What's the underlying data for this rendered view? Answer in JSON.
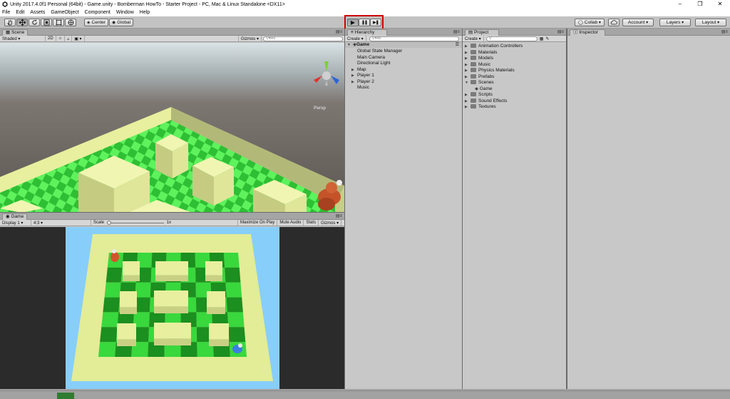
{
  "window": {
    "title": "Unity 2017.4.0f1 Personal (64bit) - Game.unity - Bomberman HowTo - Starter Project - PC, Mac & Linux Standalone <DX11>",
    "minimize": "–",
    "maximize": "❐",
    "close": "✕"
  },
  "menu": [
    "File",
    "Edit",
    "Assets",
    "GameObject",
    "Component",
    "Window",
    "Help"
  ],
  "toolbar": {
    "tool_icons": [
      "hand-icon",
      "move-icon",
      "rotate-icon",
      "scale-icon",
      "rect-icon",
      "transform-icon"
    ],
    "center_label": "Center",
    "global_label": "Global",
    "play_icon": "▶",
    "pause_icon": "❚❚",
    "step_icon": "▶❚",
    "collab_label": "Collab",
    "account_label": "Account",
    "layers_label": "Layers",
    "layout_label": "Layout"
  },
  "scene": {
    "tab_label": "Scene",
    "shading": "Shaded",
    "mode_2d": "2D",
    "gizmos_label": "Gizmos",
    "search_placeholder": "All",
    "persp_label": "Persp"
  },
  "game": {
    "tab_label": "Game",
    "display": "Display 1",
    "aspect": "4:3",
    "scale_label": "Scale",
    "scale_value": "1x",
    "maximize_on_play": "Maximize On Play",
    "mute_audio": "Mute Audio",
    "stats": "Stats",
    "gizmos": "Gizmos"
  },
  "hierarchy": {
    "tab_label": "Hierarchy",
    "create_label": "Create",
    "search_placeholder": "All",
    "scene_name": "Game",
    "items": [
      {
        "label": "Global State Manager",
        "expandable": false
      },
      {
        "label": "Main Camera",
        "expandable": false
      },
      {
        "label": "Directional Light",
        "expandable": false
      },
      {
        "label": "Map",
        "expandable": true
      },
      {
        "label": "Player 1",
        "expandable": true
      },
      {
        "label": "Player 2",
        "expandable": true
      },
      {
        "label": "Music",
        "expandable": false
      }
    ]
  },
  "project": {
    "tab_label": "Project",
    "create_label": "Create",
    "folders": [
      {
        "label": "Animation Controllers",
        "open": false
      },
      {
        "label": "Materials",
        "open": false
      },
      {
        "label": "Models",
        "open": false
      },
      {
        "label": "Music",
        "open": false
      },
      {
        "label": "Physics Materials",
        "open": false
      },
      {
        "label": "Prefabs",
        "open": false
      },
      {
        "label": "Scenes",
        "open": true
      },
      {
        "label": "Game",
        "open": false,
        "child": true
      },
      {
        "label": "Scripts",
        "open": false
      },
      {
        "label": "Sound Effects",
        "open": false
      },
      {
        "label": "Textures",
        "open": false
      }
    ]
  },
  "inspector": {
    "tab_label": "Inspector"
  },
  "colors": {
    "editor_bg": "#c8c8c8",
    "play_highlight": "#d00000",
    "grass_light": "#39d83d",
    "grass_dark": "#1b8f1f",
    "block": "#e3ec96",
    "sky": "#87cefa"
  }
}
